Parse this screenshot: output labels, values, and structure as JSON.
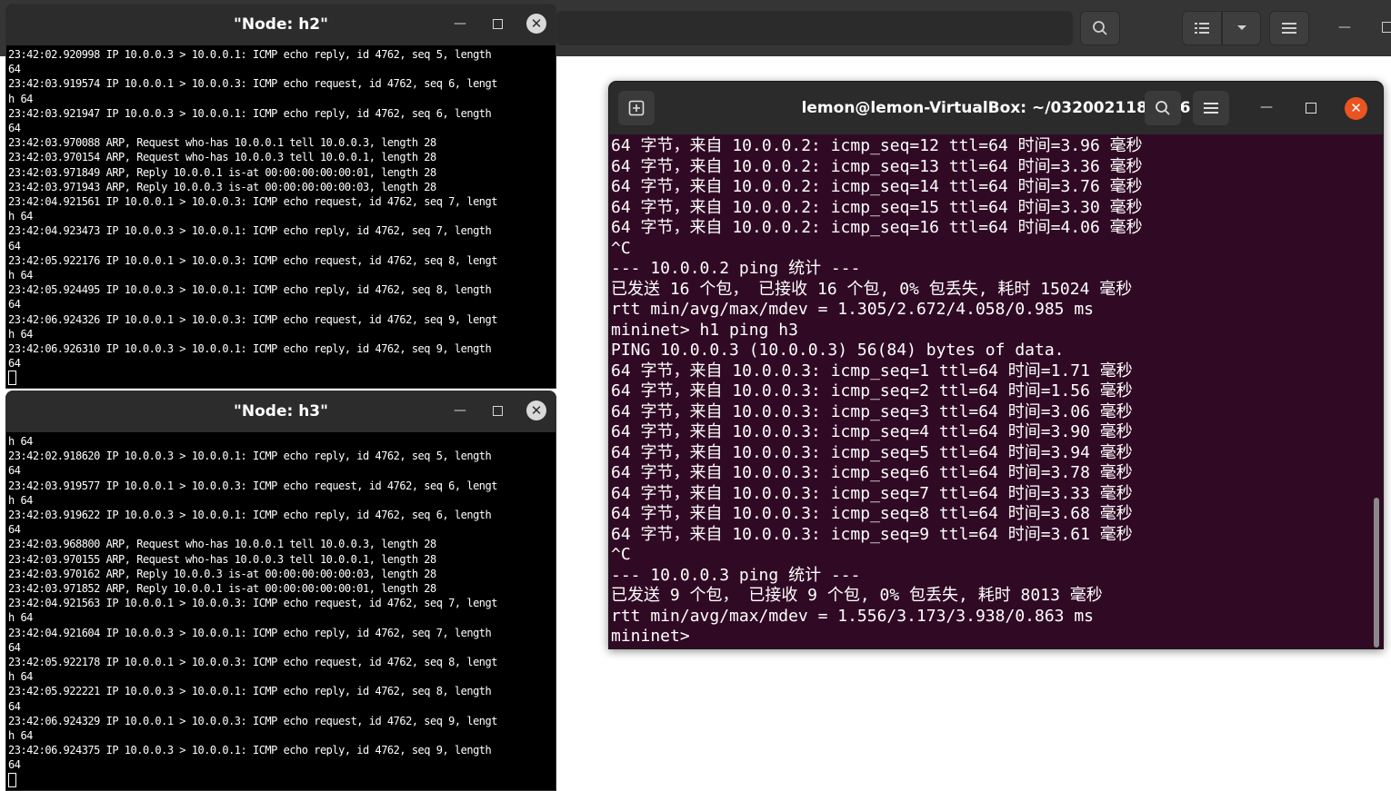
{
  "h2": {
    "title": "\"Node: h2\"",
    "lines": [
      "23:42:02.920998 IP 10.0.0.3 > 10.0.0.1: ICMP echo reply, id 4762, seq 5, length",
      "64",
      "23:42:03.919574 IP 10.0.0.1 > 10.0.0.3: ICMP echo request, id 4762, seq 6, lengt",
      "h 64",
      "23:42:03.921947 IP 10.0.0.3 > 10.0.0.1: ICMP echo reply, id 4762, seq 6, length",
      "64",
      "23:42:03.970088 ARP, Request who-has 10.0.0.1 tell 10.0.0.3, length 28",
      "23:42:03.970154 ARP, Request who-has 10.0.0.3 tell 10.0.0.1, length 28",
      "23:42:03.971849 ARP, Reply 10.0.0.1 is-at 00:00:00:00:00:01, length 28",
      "23:42:03.971943 ARP, Reply 10.0.0.3 is-at 00:00:00:00:00:03, length 28",
      "23:42:04.921561 IP 10.0.0.1 > 10.0.0.3: ICMP echo request, id 4762, seq 7, lengt",
      "h 64",
      "23:42:04.923473 IP 10.0.0.3 > 10.0.0.1: ICMP echo reply, id 4762, seq 7, length",
      "64",
      "23:42:05.922176 IP 10.0.0.1 > 10.0.0.3: ICMP echo request, id 4762, seq 8, lengt",
      "h 64",
      "23:42:05.924495 IP 10.0.0.3 > 10.0.0.1: ICMP echo reply, id 4762, seq 8, length",
      "64",
      "23:42:06.924326 IP 10.0.0.1 > 10.0.0.3: ICMP echo request, id 4762, seq 9, lengt",
      "h 64",
      "23:42:06.926310 IP 10.0.0.3 > 10.0.0.1: ICMP echo reply, id 4762, seq 9, length",
      "64"
    ]
  },
  "h3": {
    "title": "\"Node: h3\"",
    "lines": [
      "h 64",
      "23:42:02.918620 IP 10.0.0.3 > 10.0.0.1: ICMP echo reply, id 4762, seq 5, length",
      "64",
      "23:42:03.919577 IP 10.0.0.1 > 10.0.0.3: ICMP echo request, id 4762, seq 6, lengt",
      "h 64",
      "23:42:03.919622 IP 10.0.0.3 > 10.0.0.1: ICMP echo reply, id 4762, seq 6, length",
      "64",
      "23:42:03.968800 ARP, Request who-has 10.0.0.1 tell 10.0.0.3, length 28",
      "23:42:03.970155 ARP, Request who-has 10.0.0.3 tell 10.0.0.1, length 28",
      "23:42:03.970162 ARP, Reply 10.0.0.3 is-at 00:00:00:00:00:03, length 28",
      "23:42:03.971852 ARP, Reply 10.0.0.1 is-at 00:00:00:00:00:01, length 28",
      "23:42:04.921563 IP 10.0.0.1 > 10.0.0.3: ICMP echo request, id 4762, seq 7, lengt",
      "h 64",
      "23:42:04.921604 IP 10.0.0.3 > 10.0.0.1: ICMP echo reply, id 4762, seq 7, length",
      "64",
      "23:42:05.922178 IP 10.0.0.1 > 10.0.0.3: ICMP echo request, id 4762, seq 8, lengt",
      "h 64",
      "23:42:05.922221 IP 10.0.0.3 > 10.0.0.1: ICMP echo reply, id 4762, seq 8, length",
      "64",
      "23:42:06.924329 IP 10.0.0.1 > 10.0.0.3: ICMP echo request, id 4762, seq 9, lengt",
      "h 64",
      "23:42:06.924375 IP 10.0.0.3 > 10.0.0.1: ICMP echo reply, id 4762, seq 9, length",
      "64"
    ]
  },
  "terminal": {
    "title": "lemon@lemon-VirtualBox: ~/032002118/lab6",
    "lines": [
      "64 字节，来自 10.0.0.2: icmp_seq=12 ttl=64 时间=3.96 毫秒",
      "64 字节，来自 10.0.0.2: icmp_seq=13 ttl=64 时间=3.36 毫秒",
      "64 字节，来自 10.0.0.2: icmp_seq=14 ttl=64 时间=3.76 毫秒",
      "64 字节，来自 10.0.0.2: icmp_seq=15 ttl=64 时间=3.30 毫秒",
      "64 字节，来自 10.0.0.2: icmp_seq=16 ttl=64 时间=4.06 毫秒",
      "^C",
      "--- 10.0.0.2 ping 统计 ---",
      "已发送 16 个包， 已接收 16 个包, 0% 包丢失, 耗时 15024 毫秒",
      "rtt min/avg/max/mdev = 1.305/2.672/4.058/0.985 ms",
      "mininet> h1 ping h3",
      "PING 10.0.0.3 (10.0.0.3) 56(84) bytes of data.",
      "64 字节，来自 10.0.0.3: icmp_seq=1 ttl=64 时间=1.71 毫秒",
      "64 字节，来自 10.0.0.3: icmp_seq=2 ttl=64 时间=1.56 毫秒",
      "64 字节，来自 10.0.0.3: icmp_seq=3 ttl=64 时间=3.06 毫秒",
      "64 字节，来自 10.0.0.3: icmp_seq=4 ttl=64 时间=3.90 毫秒",
      "64 字节，来自 10.0.0.3: icmp_seq=5 ttl=64 时间=3.94 毫秒",
      "64 字节，来自 10.0.0.3: icmp_seq=6 ttl=64 时间=3.78 毫秒",
      "64 字节，来自 10.0.0.3: icmp_seq=7 ttl=64 时间=3.33 毫秒",
      "64 字节，来自 10.0.0.3: icmp_seq=8 ttl=64 时间=3.68 毫秒",
      "64 字节，来自 10.0.0.3: icmp_seq=9 ttl=64 时间=3.61 毫秒",
      "^C",
      "--- 10.0.0.3 ping 统计 ---",
      "已发送 9 个包， 已接收 9 个包, 0% 包丢失, 耗时 8013 毫秒",
      "rtt min/avg/max/mdev = 1.556/3.173/3.938/0.863 ms",
      "mininet> "
    ]
  },
  "icons": {
    "search": "search-icon",
    "list_view": "list-view-icon",
    "dropdown": "chevron-down-icon",
    "menu": "hamburger-menu-icon",
    "new_tab": "new-tab-icon",
    "minimize": "minimize-icon",
    "maximize": "maximize-icon",
    "close": "close-icon"
  },
  "colors": {
    "terminal_bg": "#300a24",
    "close_accent": "#e95420",
    "xterm_bg": "#000000"
  }
}
